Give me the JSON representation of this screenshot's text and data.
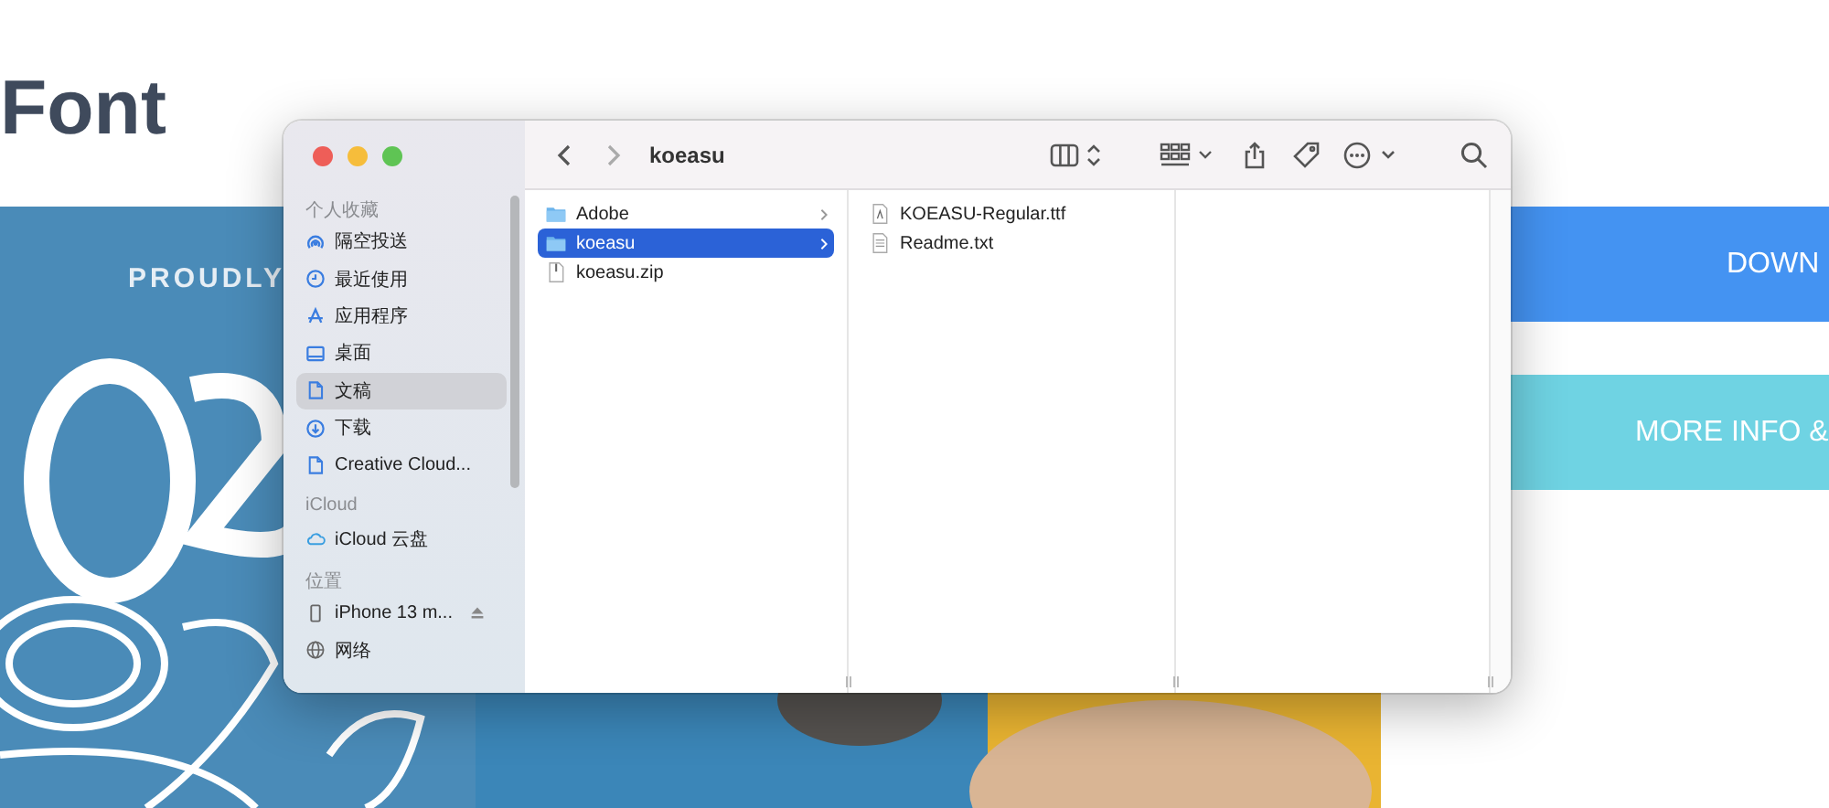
{
  "page": {
    "heading": "Font",
    "banner_text": "PROUDLY",
    "buttons": [
      {
        "label": "DOWN",
        "kind": "primary"
      },
      {
        "label": "MORE INFO &",
        "kind": "secondary"
      }
    ]
  },
  "finder": {
    "title": "koeasu",
    "sidebar": [
      {
        "heading": "个人收藏",
        "items": [
          {
            "label": "隔空投送",
            "kind": "airdrop",
            "selected": false
          },
          {
            "label": "最近使用",
            "kind": "recent",
            "selected": false
          },
          {
            "label": "应用程序",
            "kind": "apps",
            "selected": false
          },
          {
            "label": "桌面",
            "kind": "desktop",
            "selected": false
          },
          {
            "label": "文稿",
            "kind": "document",
            "selected": true
          },
          {
            "label": "下载",
            "kind": "download",
            "selected": false
          },
          {
            "label": "Creative Cloud...",
            "kind": "file",
            "selected": false
          }
        ]
      },
      {
        "heading": "iCloud",
        "items": [
          {
            "label": "iCloud 云盘",
            "kind": "cloud",
            "selected": false
          }
        ]
      },
      {
        "heading": "位置",
        "items": [
          {
            "label": "iPhone 13 m...",
            "kind": "phone",
            "selected": false
          },
          {
            "label": "网络",
            "kind": "network",
            "selected": false
          }
        ]
      }
    ],
    "columns": [
      [
        {
          "name": "Adobe",
          "kind": "folder",
          "selected": false
        },
        {
          "name": "koeasu",
          "kind": "folder",
          "selected": true
        },
        {
          "name": "koeasu.zip",
          "kind": "zip",
          "selected": false
        }
      ],
      [
        {
          "name": "KOEASU-Regular.ttf",
          "kind": "font",
          "selected": false
        },
        {
          "name": "Readme.txt",
          "kind": "text",
          "selected": false
        }
      ]
    ]
  }
}
